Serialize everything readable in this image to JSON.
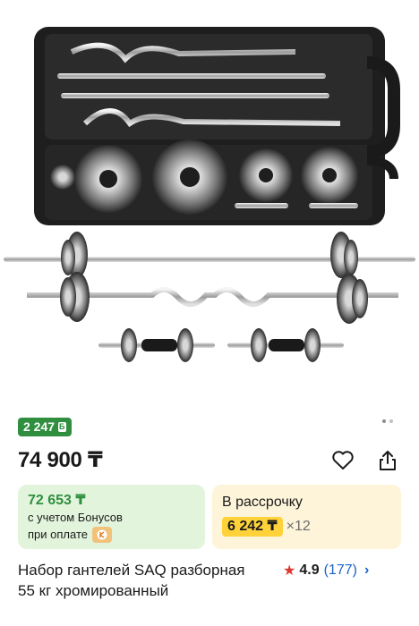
{
  "product": {
    "bonus_badge": "2 247",
    "bonus_badge_icon": "Б",
    "price": "74 900 ₸",
    "title": "Набор гантелей SAQ разборная 55 кг хромированный"
  },
  "bonus_card": {
    "amount": "72 653 ₸",
    "line1": "с учетом Бонусов",
    "line2": "при оплате"
  },
  "installment_card": {
    "title": "В рассрочку",
    "amount": "6 242 ₸",
    "multiplier": "×12"
  },
  "rating": {
    "score": "4.9",
    "count": "(177)"
  },
  "gallery": {
    "total": 2,
    "active_index": 1
  },
  "icons": {
    "favorite": "heart-icon",
    "share": "share-icon",
    "rating": "star-icon",
    "chevron": "chevron-right-icon",
    "kaspi": "kaspi-logo-icon"
  },
  "colors": {
    "bonus_green": "#2f8f3f",
    "bonus_card_bg": "#e3f4dc",
    "installment_card_bg": "#fdf4d9",
    "installment_highlight": "#ffd23a",
    "star_red": "#e0362f",
    "link_blue": "#1f63c9"
  }
}
